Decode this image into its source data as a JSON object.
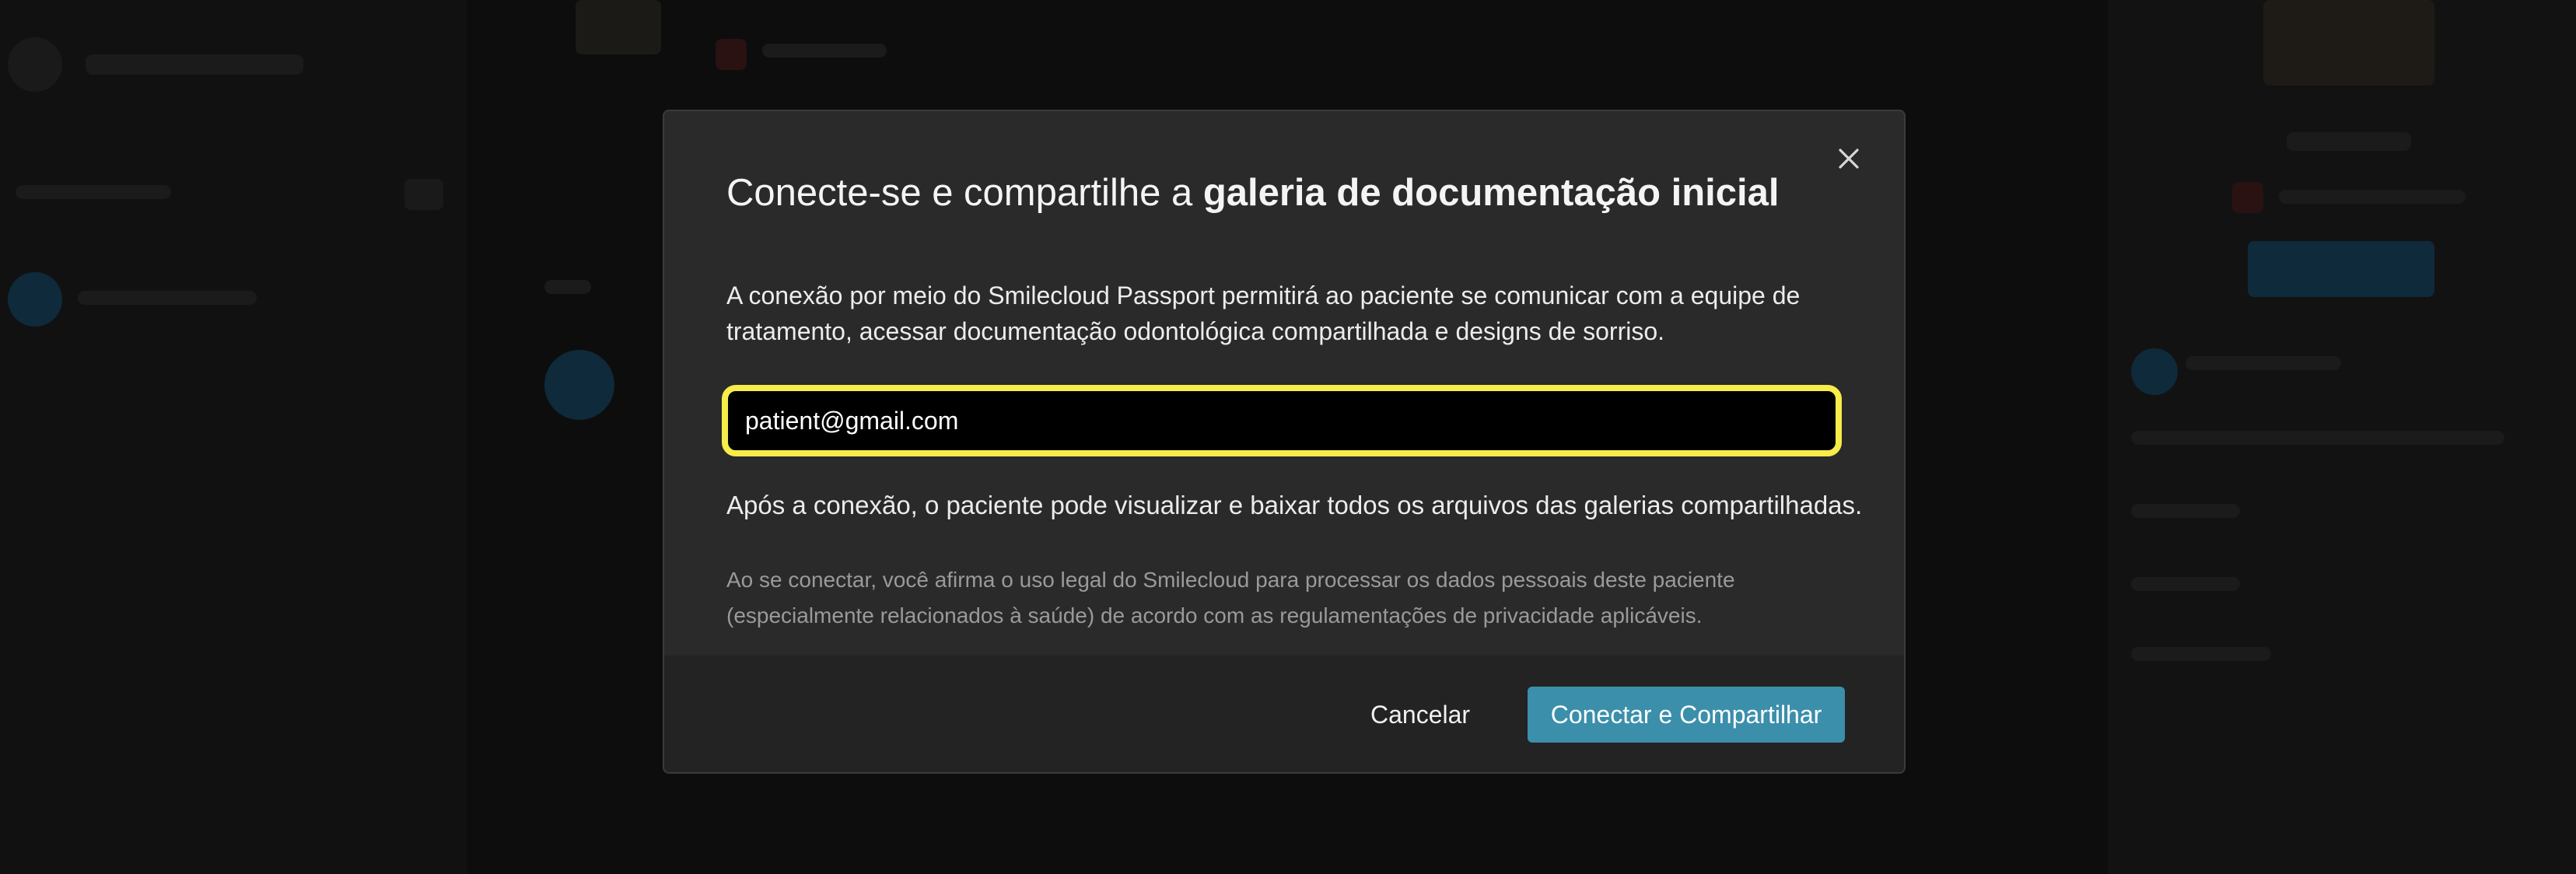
{
  "dialog": {
    "title_prefix": "Conecte-se e compartilhe a ",
    "title_bold": "galeria de documentação inicial",
    "description": "A conexão por meio do Smilecloud Passport permitirá ao paciente se comunicar com a equipe de tratamento, acessar documentação odontológica compartilhada e designs de sorriso.",
    "email_value": "patient@gmail.com",
    "after_connection": "Após a conexão, o paciente pode visualizar e baixar todos os arquivos das galerias compartilhadas.",
    "legal_notice": "Ao se conectar, você afirma o uso legal do Smilecloud para processar os dados pessoais deste paciente (especialmente relacionados à saúde) de acordo com as regulamentações de privacidade aplicáveis.",
    "cancel_label": "Cancelar",
    "confirm_label": "Conectar e Compartilhar",
    "close_icon": "close-icon"
  },
  "colors": {
    "accent": "#3b8fab",
    "focus_ring": "#f6ec4a",
    "modal_bg": "#2a2a2a",
    "footer_bg": "#232323"
  }
}
